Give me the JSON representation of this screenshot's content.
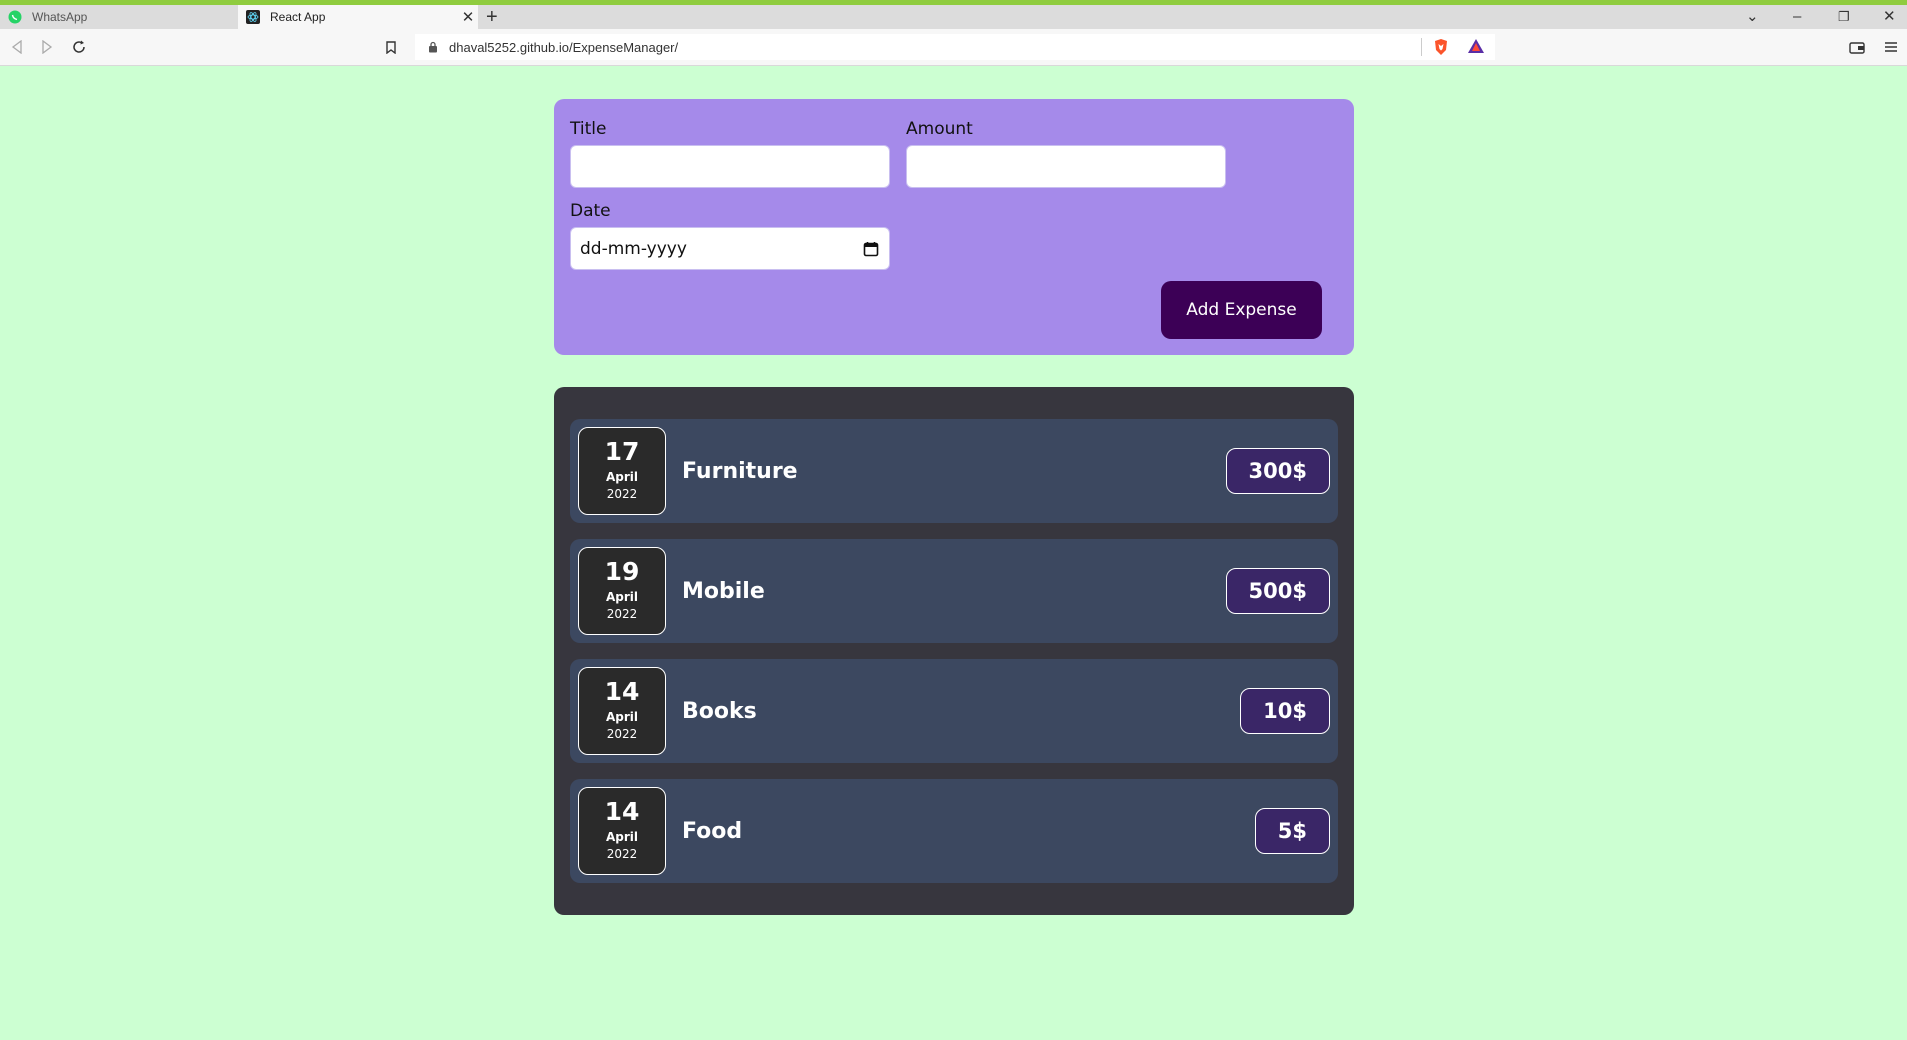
{
  "browser": {
    "tabs": [
      {
        "title": "WhatsApp",
        "active": false,
        "favicon": "whatsapp-icon"
      },
      {
        "title": "React App",
        "active": true,
        "favicon": "react-icon"
      }
    ],
    "url": "dhaval5252.github.io/ExpenseManager/",
    "accent_color": "#8fcc3f"
  },
  "form": {
    "title_label": "Title",
    "title_value": "",
    "amount_label": "Amount",
    "amount_value": "",
    "date_label": "Date",
    "date_placeholder": "dd-mm-yyyy",
    "submit_label": "Add Expense",
    "background_color": "#a58aea",
    "button_color": "#3c0056"
  },
  "expenses": [
    {
      "day": "17",
      "month": "April",
      "year": "2022",
      "title": "Furniture",
      "amount": "300$"
    },
    {
      "day": "19",
      "month": "April",
      "year": "2022",
      "title": "Mobile",
      "amount": "500$"
    },
    {
      "day": "14",
      "month": "April",
      "year": "2022",
      "title": "Books",
      "amount": "10$"
    },
    {
      "day": "14",
      "month": "April",
      "year": "2022",
      "title": "Food",
      "amount": "5$"
    }
  ],
  "colors": {
    "page_background": "#ccffd2",
    "list_background": "#37363e",
    "item_background": "#3c4860",
    "amount_background": "#3a2667"
  }
}
